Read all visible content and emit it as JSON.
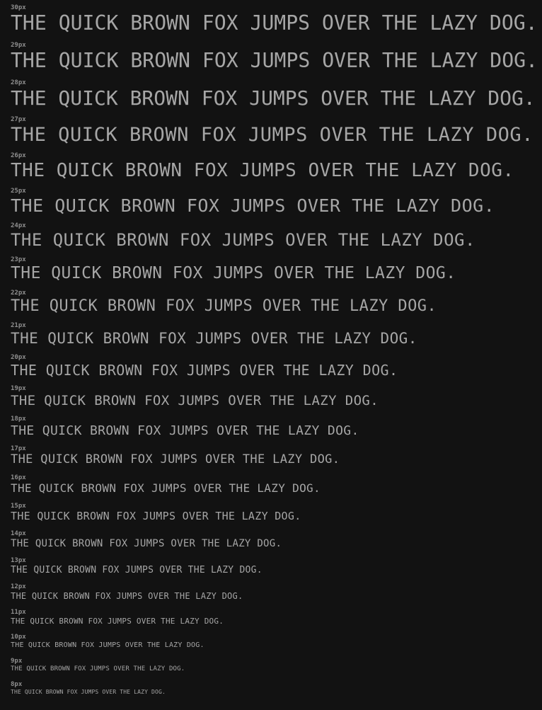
{
  "sample_text": "THE QUICK BROWN FOX JUMPS OVER THE LAZY DOG.",
  "colors": {
    "background": "#121212",
    "label": "#8e8e8e",
    "sample": "#a6a6a6"
  },
  "rows": [
    {
      "size_label": "30px"
    },
    {
      "size_label": "29px"
    },
    {
      "size_label": "28px"
    },
    {
      "size_label": "27px"
    },
    {
      "size_label": "26px"
    },
    {
      "size_label": "25px"
    },
    {
      "size_label": "24px"
    },
    {
      "size_label": "23px"
    },
    {
      "size_label": "22px"
    },
    {
      "size_label": "21px"
    },
    {
      "size_label": "20px"
    },
    {
      "size_label": "19px"
    },
    {
      "size_label": "18px"
    },
    {
      "size_label": "17px"
    },
    {
      "size_label": "16px"
    },
    {
      "size_label": "15px"
    },
    {
      "size_label": "14px"
    },
    {
      "size_label": "13px"
    },
    {
      "size_label": "12px"
    },
    {
      "size_label": "11px"
    },
    {
      "size_label": "10px"
    },
    {
      "size_label": "9px"
    },
    {
      "size_label": "8px"
    }
  ]
}
